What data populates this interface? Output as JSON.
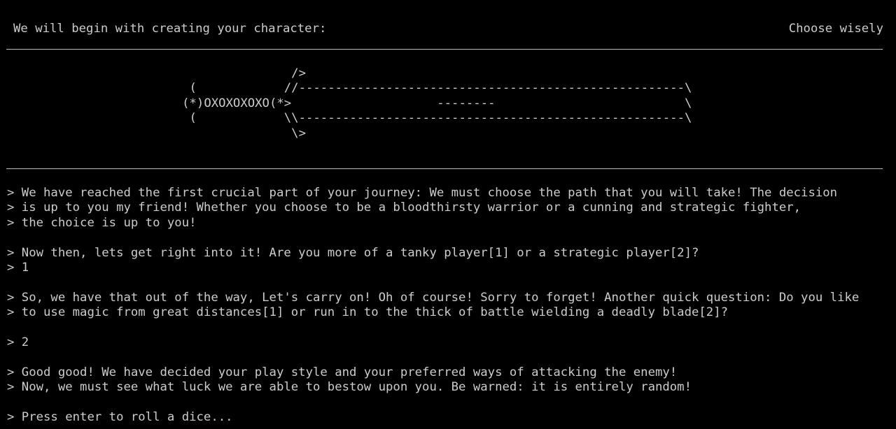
{
  "header": {
    "left_text": "We will begin with creating your character:",
    "right_text": "Choose wisely"
  },
  "art": {
    "lines": [
      "                                        />",
      "                          (            //-----------------------------------------------------\\",
      "                         (*)OXOXOXOXO(*>                    --------                          \\",
      "                          (            \\\\-----------------------------------------------------\\",
      "                                        \\>"
    ]
  },
  "transcript": {
    "p1": [
      "> We have reached the first crucial part of your journey: We must choose the path that you will take! The decision",
      "> is up to you my friend! Whether you choose to be a bloodthirsty warrior or a cunning and strategic fighter,",
      "> the choice is up to you!"
    ],
    "q1": "> Now then, lets get right into it! Are you more of a tanky player[1] or a strategic player[2]?",
    "a1": "> 1",
    "q2": [
      "> So, we have that out of the way, Let's carry on! Oh of course! Sorry to forget! Another quick question: Do you like",
      "> to use magic from great distances[1] or run in to the thick of battle wielding a deadly blade[2]?"
    ],
    "a2": "> 2",
    "p2": [
      "> Good good! We have decided your play style and your preferred ways of attacking the enemy!",
      "> Now, we must see what luck we are able to bestow upon you. Be warned: it is entirely random!"
    ],
    "prompt": "> Press enter to roll a dice..."
  }
}
